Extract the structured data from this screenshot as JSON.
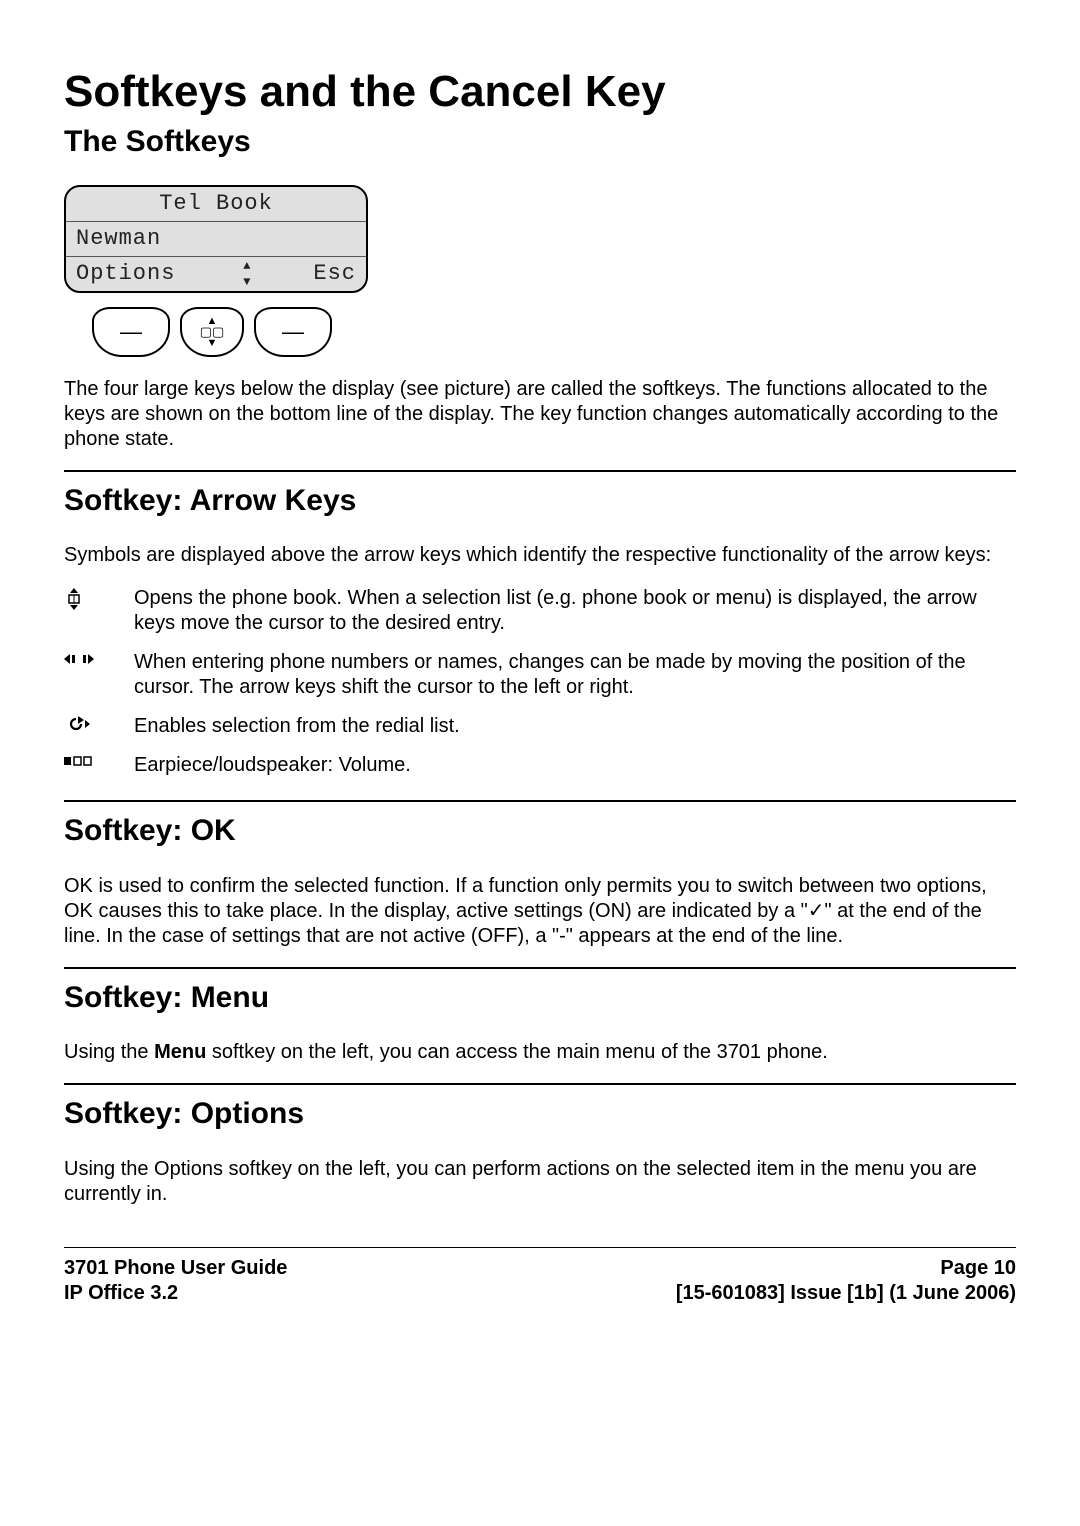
{
  "title": "Softkeys and the Cancel Key",
  "sections": {
    "softkeys": {
      "heading": "The Softkeys",
      "body": "The four large keys below the display (see picture) are called the softkeys. The functions allocated to the keys are shown on the bottom line of the display. The key function changes automatically according to the phone state."
    },
    "arrow": {
      "heading": "Softkey: Arrow Keys",
      "intro": "Symbols are displayed above the arrow keys which identify the respective functionality of the arrow keys:",
      "items": [
        {
          "icon": "phonebook-arrows-icon",
          "text": "Opens the phone book. When a selection list (e.g. phone book or menu) is displayed, the arrow keys move the cursor to the desired entry."
        },
        {
          "icon": "cursor-lr-icon",
          "text": "When entering phone numbers or names, changes can be made by moving the position of the cursor. The arrow keys shift the cursor to the left or right."
        },
        {
          "icon": "redial-icon",
          "text": "Enables selection from the redial list."
        },
        {
          "icon": "volume-bar-icon",
          "text": "Earpiece/loudspeaker: Volume."
        }
      ]
    },
    "ok": {
      "heading": "Softkey: OK",
      "body": "OK is used to confirm the selected function. If a function only permits you to switch between two options, OK causes this to take place. In the display, active settings (ON) are indicated by a \"✓\" at the end of the line. In the case of settings that are not active (OFF), a \"-\" appears at the end of the line."
    },
    "menu": {
      "heading": "Softkey: Menu",
      "body_prefix": "Using the ",
      "body_bold": "Menu",
      "body_suffix": " softkey on the left, you can access the main menu of the 3701 phone."
    },
    "options": {
      "heading": "Softkey: Options",
      "body": "Using the Options softkey on the left, you can perform actions on the selected item in the menu you are currently in."
    }
  },
  "lcd": {
    "title": "Tel Book",
    "entry": "Newman",
    "left_softkey": "Options",
    "right_softkey": "Esc"
  },
  "footer": {
    "left1": "3701 Phone User Guide",
    "left2": "IP Office 3.2",
    "right1": "Page 10",
    "right2": "[15-601083] Issue [1b] (1 June 2006)"
  }
}
